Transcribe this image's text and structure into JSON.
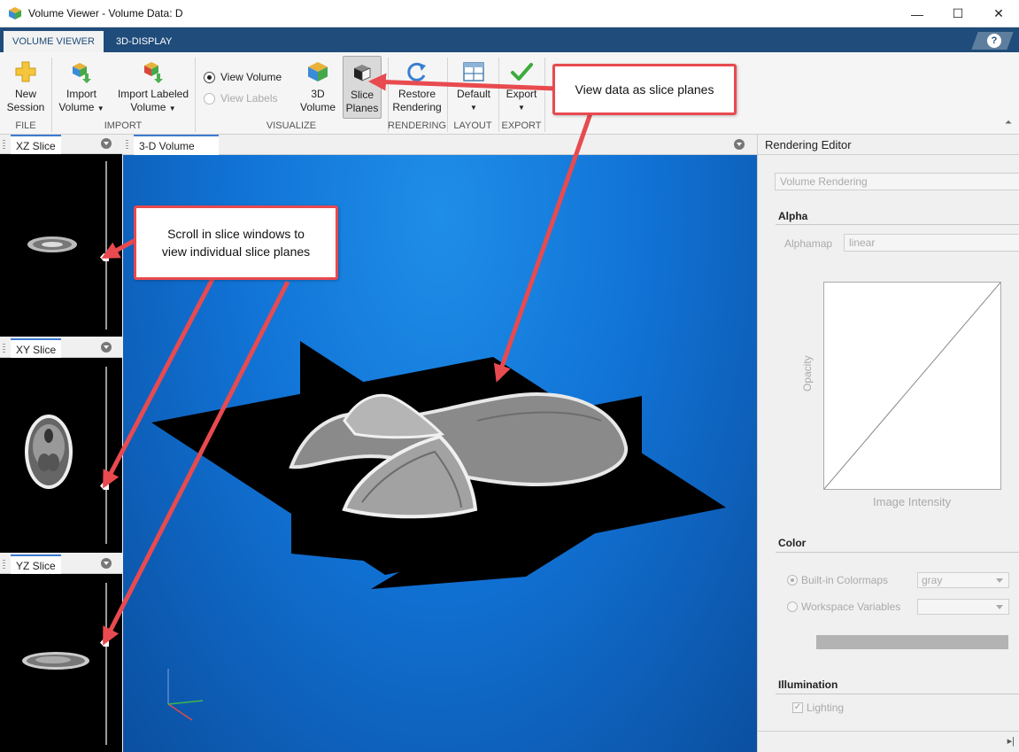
{
  "window": {
    "title": "Volume Viewer - Volume Data: D",
    "minimize_glyph": "—",
    "maximize_glyph": "☐",
    "close_glyph": "✕"
  },
  "tabs": [
    {
      "label": "VOLUME VIEWER",
      "active": true
    },
    {
      "label": "3D-DISPLAY",
      "active": false
    }
  ],
  "help_glyph": "?",
  "ribbon": {
    "file": {
      "group_label": "FILE",
      "new_session": [
        "New",
        "Session"
      ]
    },
    "import": {
      "group_label": "IMPORT",
      "import_volume": [
        "Import",
        "Volume"
      ],
      "import_labeled_volume": [
        "Import Labeled",
        "Volume"
      ]
    },
    "visualize": {
      "group_label": "VISUALIZE",
      "view_volume": "View Volume",
      "view_labels": "View Labels",
      "volume_3d": [
        "3D",
        "Volume"
      ],
      "slice_planes": [
        "Slice",
        "Planes"
      ]
    },
    "rendering": {
      "group_label": "RENDERING",
      "restore_rendering": [
        "Restore",
        "Rendering"
      ]
    },
    "layout": {
      "group_label": "LAYOUT",
      "default": "Default"
    },
    "export": {
      "group_label": "EXPORT",
      "export": "Export"
    },
    "caret_glyph": "▼",
    "collapse_glyph": "⏶"
  },
  "slices": [
    {
      "label": "XZ Slice",
      "slider_fraction": 0.55
    },
    {
      "label": "XY Slice",
      "slider_fraction": 0.57
    },
    {
      "label": "YZ Slice",
      "slider_fraction": 0.38
    }
  ],
  "volume_panel": {
    "label": "3-D Volume"
  },
  "editor": {
    "title": "Rendering Editor",
    "mode": "Volume Rendering",
    "alpha_section": "Alpha",
    "alphamap_label": "Alphamap",
    "alphamap_value": "linear",
    "opacity_label": "Opacity",
    "intensity_label": "Image Intensity",
    "color_section": "Color",
    "builtin_colormaps": "Built-in Colormaps",
    "colormap_value": "gray",
    "workspace_variables": "Workspace Variables",
    "workspace_value": "",
    "illumination_section": "Illumination",
    "lighting_label": "Lighting",
    "lighting_checked": true,
    "footer_glyph": "▸|"
  },
  "callouts": {
    "slice_planes": "View data as slice planes",
    "scroll_line1": "Scroll in slice windows to",
    "scroll_line2": "view individual slice planes"
  },
  "colors": {
    "accent_tab": "#1f4c7a",
    "callout_red": "#e84a4f",
    "canvas_blue": "#1173d6"
  }
}
